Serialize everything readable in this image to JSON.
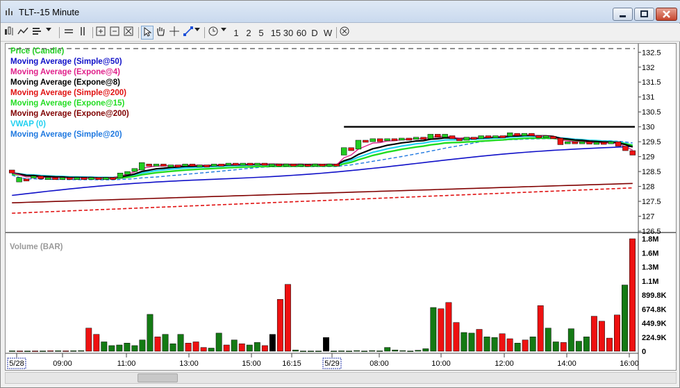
{
  "window": {
    "title": "TLT--15 Minute"
  },
  "toolbar": {
    "intervals": [
      "1",
      "2",
      "5",
      "15",
      "30",
      "60",
      "D",
      "W"
    ]
  },
  "legend": [
    {
      "label": "Price (Candle)",
      "color": "#22cc22"
    },
    {
      "label": "Moving Average (Simple@50)",
      "color": "#1010c8"
    },
    {
      "label": "Moving Average (Expone@4)",
      "color": "#e0208a"
    },
    {
      "label": "Moving Average (Expone@8)",
      "color": "#000000"
    },
    {
      "label": "Moving Average (Simple@200)",
      "color": "#e01010"
    },
    {
      "label": "Moving Average (Expone@15)",
      "color": "#22dd22"
    },
    {
      "label": "Moving Average (Expone@200)",
      "color": "#800000"
    },
    {
      "label": "VWAP (0)",
      "color": "#20d0f0"
    },
    {
      "label": "Moving Average (Simple@20)",
      "color": "#1e78e0"
    }
  ],
  "price_axis": [
    "132.5",
    "132",
    "131.5",
    "131",
    "130.5",
    "130",
    "129.5",
    "129",
    "128.5",
    "128",
    "127.5",
    "127",
    "126.5"
  ],
  "volume_label": "Volume (BAR)",
  "volume_axis": [
    "1.8M",
    "1.6M",
    "1.3M",
    "1.1M",
    "899.8K",
    "674.8K",
    "449.9K",
    "224.9K",
    "0"
  ],
  "chart_data": {
    "type": "bar",
    "time_labels": [
      "5/28",
      "09:00",
      "11:00",
      "13:00",
      "15:00",
      "16:15",
      "5/29",
      "08:00",
      "10:00",
      "12:00",
      "14:00",
      "16:00"
    ],
    "price": {
      "ylim": [
        126.5,
        132.6
      ],
      "horizontal_line": 130.0,
      "sma200_start": 127.1,
      "sma200_end": 127.95,
      "ema200_start": 127.45,
      "ema200_end": 128.1,
      "sma50_start": 127.7,
      "sma50_end": 129.35,
      "candles": [
        {
          "o": 128.55,
          "c": 128.45,
          "up": false
        },
        {
          "o": 128.15,
          "c": 128.3,
          "up": true
        },
        {
          "o": 128.25,
          "c": 128.2,
          "up": false
        },
        {
          "o": 128.3,
          "c": 128.35,
          "up": true
        },
        {
          "o": 128.35,
          "c": 128.25,
          "up": false
        },
        {
          "o": 128.25,
          "c": 128.3,
          "up": true
        },
        {
          "o": 128.3,
          "c": 128.28,
          "up": false
        },
        {
          "o": 128.28,
          "c": 128.3,
          "up": true
        },
        {
          "o": 128.3,
          "c": 128.25,
          "up": false
        },
        {
          "o": 128.25,
          "c": 128.3,
          "up": true
        },
        {
          "o": 128.3,
          "c": 128.28,
          "up": false
        },
        {
          "o": 128.25,
          "c": 128.3,
          "up": true
        },
        {
          "o": 128.3,
          "c": 128.25,
          "up": false
        },
        {
          "o": 128.25,
          "c": 128.3,
          "up": true
        },
        {
          "o": 128.3,
          "c": 128.28,
          "up": false
        },
        {
          "o": 128.28,
          "c": 128.45,
          "up": true
        },
        {
          "o": 128.4,
          "c": 128.5,
          "up": true
        },
        {
          "o": 128.5,
          "c": 128.6,
          "up": true
        },
        {
          "o": 128.55,
          "c": 128.8,
          "up": true
        },
        {
          "o": 128.75,
          "c": 128.7,
          "up": false
        },
        {
          "o": 128.7,
          "c": 128.75,
          "up": true
        },
        {
          "o": 128.75,
          "c": 128.68,
          "up": false
        },
        {
          "o": 128.7,
          "c": 128.72,
          "up": true
        },
        {
          "o": 128.72,
          "c": 128.7,
          "up": false
        },
        {
          "o": 128.7,
          "c": 128.75,
          "up": true
        },
        {
          "o": 128.75,
          "c": 128.7,
          "up": false
        },
        {
          "o": 128.7,
          "c": 128.72,
          "up": true
        },
        {
          "o": 128.72,
          "c": 128.7,
          "up": false
        },
        {
          "o": 128.7,
          "c": 128.75,
          "up": true
        },
        {
          "o": 128.75,
          "c": 128.72,
          "up": false
        },
        {
          "o": 128.72,
          "c": 128.78,
          "up": true
        },
        {
          "o": 128.78,
          "c": 128.72,
          "up": false
        },
        {
          "o": 128.72,
          "c": 128.78,
          "up": true
        },
        {
          "o": 128.78,
          "c": 128.75,
          "up": false
        },
        {
          "o": 128.75,
          "c": 128.78,
          "up": true
        },
        {
          "o": 128.78,
          "c": 128.72,
          "up": false
        },
        {
          "o": 128.72,
          "c": 128.75,
          "up": true
        },
        {
          "o": 128.75,
          "c": 128.72,
          "up": false
        },
        {
          "o": 128.72,
          "c": 128.75,
          "up": true
        },
        {
          "o": 128.75,
          "c": 128.72,
          "up": false
        },
        {
          "o": 128.72,
          "c": 128.74,
          "up": true
        },
        {
          "o": 128.74,
          "c": 128.72,
          "up": false
        },
        {
          "o": 128.72,
          "c": 128.75,
          "up": true
        },
        {
          "o": 128.75,
          "c": 128.72,
          "up": false
        },
        {
          "o": 128.7,
          "c": 128.75,
          "up": true
        },
        {
          "o": 128.75,
          "c": 128.72,
          "up": false
        },
        {
          "o": 129.05,
          "c": 129.3,
          "up": true
        },
        {
          "o": 129.3,
          "c": 129.2,
          "up": false
        },
        {
          "o": 129.25,
          "c": 129.55,
          "up": true
        },
        {
          "o": 129.55,
          "c": 129.5,
          "up": false
        },
        {
          "o": 129.5,
          "c": 129.6,
          "up": true
        },
        {
          "o": 129.6,
          "c": 129.5,
          "up": false
        },
        {
          "o": 129.55,
          "c": 129.6,
          "up": true
        },
        {
          "o": 129.6,
          "c": 129.55,
          "up": false
        },
        {
          "o": 129.55,
          "c": 129.62,
          "up": true
        },
        {
          "o": 129.62,
          "c": 129.58,
          "up": false
        },
        {
          "o": 129.58,
          "c": 129.65,
          "up": true
        },
        {
          "o": 129.65,
          "c": 129.58,
          "up": false
        },
        {
          "o": 129.6,
          "c": 129.75,
          "up": true
        },
        {
          "o": 129.75,
          "c": 129.65,
          "up": false
        },
        {
          "o": 129.65,
          "c": 129.75,
          "up": true
        },
        {
          "o": 129.7,
          "c": 129.6,
          "up": false
        },
        {
          "o": 129.6,
          "c": 129.55,
          "up": false
        },
        {
          "o": 129.55,
          "c": 129.65,
          "up": true
        },
        {
          "o": 129.65,
          "c": 129.6,
          "up": false
        },
        {
          "o": 129.6,
          "c": 129.7,
          "up": true
        },
        {
          "o": 129.7,
          "c": 129.65,
          "up": false
        },
        {
          "o": 129.65,
          "c": 129.7,
          "up": true
        },
        {
          "o": 129.7,
          "c": 129.68,
          "up": false
        },
        {
          "o": 129.68,
          "c": 129.8,
          "up": true
        },
        {
          "o": 129.78,
          "c": 129.7,
          "up": false
        },
        {
          "o": 129.7,
          "c": 129.78,
          "up": true
        },
        {
          "o": 129.78,
          "c": 129.7,
          "up": false
        },
        {
          "o": 129.7,
          "c": 129.65,
          "up": false
        },
        {
          "o": 129.65,
          "c": 129.7,
          "up": true
        },
        {
          "o": 129.68,
          "c": 129.6,
          "up": false
        },
        {
          "o": 129.62,
          "c": 129.4,
          "up": false
        },
        {
          "o": 129.45,
          "c": 129.5,
          "up": true
        },
        {
          "o": 129.5,
          "c": 129.45,
          "up": false
        },
        {
          "o": 129.45,
          "c": 129.5,
          "up": true
        },
        {
          "o": 129.5,
          "c": 129.42,
          "up": false
        },
        {
          "o": 129.45,
          "c": 129.48,
          "up": true
        },
        {
          "o": 129.48,
          "c": 129.42,
          "up": false
        },
        {
          "o": 129.45,
          "c": 129.5,
          "up": true
        },
        {
          "o": 129.5,
          "c": 129.35,
          "up": false
        },
        {
          "o": 129.35,
          "c": 129.2,
          "up": false
        },
        {
          "o": 129.2,
          "c": 129.05,
          "up": false
        }
      ]
    },
    "volume": {
      "ylim": [
        0,
        1800000
      ],
      "bars": [
        {
          "v": 6000,
          "c": "g"
        },
        {
          "v": 5000,
          "c": "r"
        },
        {
          "v": 4000,
          "c": "g"
        },
        {
          "v": 5000,
          "c": "r"
        },
        {
          "v": 5000,
          "c": "g"
        },
        {
          "v": 8000,
          "c": "r"
        },
        {
          "v": 8000,
          "c": "g"
        },
        {
          "v": 6000,
          "c": "r"
        },
        {
          "v": 8000,
          "c": "g"
        },
        {
          "v": 10000,
          "c": "g"
        },
        {
          "v": 370000,
          "c": "r"
        },
        {
          "v": 270000,
          "c": "r"
        },
        {
          "v": 150000,
          "c": "g"
        },
        {
          "v": 90000,
          "c": "g"
        },
        {
          "v": 100000,
          "c": "g"
        },
        {
          "v": 130000,
          "c": "g"
        },
        {
          "v": 90000,
          "c": "g"
        },
        {
          "v": 180000,
          "c": "g"
        },
        {
          "v": 590000,
          "c": "g"
        },
        {
          "v": 230000,
          "c": "r"
        },
        {
          "v": 270000,
          "c": "g"
        },
        {
          "v": 120000,
          "c": "g"
        },
        {
          "v": 270000,
          "c": "g"
        },
        {
          "v": 130000,
          "c": "r"
        },
        {
          "v": 150000,
          "c": "r"
        },
        {
          "v": 60000,
          "c": "r"
        },
        {
          "v": 50000,
          "c": "g"
        },
        {
          "v": 290000,
          "c": "g"
        },
        {
          "v": 100000,
          "c": "r"
        },
        {
          "v": 180000,
          "c": "g"
        },
        {
          "v": 120000,
          "c": "r"
        },
        {
          "v": 100000,
          "c": "g"
        },
        {
          "v": 140000,
          "c": "g"
        },
        {
          "v": 90000,
          "c": "r"
        },
        {
          "v": 270000,
          "c": "k"
        },
        {
          "v": 830000,
          "c": "r"
        },
        {
          "v": 1070000,
          "c": "r"
        },
        {
          "v": 20000,
          "c": "g"
        },
        {
          "v": 4000,
          "c": "g"
        },
        {
          "v": 4000,
          "c": "g"
        },
        {
          "v": 4000,
          "c": "g"
        },
        {
          "v": 220000,
          "c": "k"
        },
        {
          "v": 4000,
          "c": "g"
        },
        {
          "v": 6000,
          "c": "g"
        },
        {
          "v": 4000,
          "c": "g"
        },
        {
          "v": 10000,
          "c": "g"
        },
        {
          "v": 4000,
          "c": "g"
        },
        {
          "v": 10000,
          "c": "g"
        },
        {
          "v": 6000,
          "c": "g"
        },
        {
          "v": 60000,
          "c": "g"
        },
        {
          "v": 20000,
          "c": "g"
        },
        {
          "v": 10000,
          "c": "g"
        },
        {
          "v": 4000,
          "c": "g"
        },
        {
          "v": 15000,
          "c": "g"
        },
        {
          "v": 40000,
          "c": "g"
        },
        {
          "v": 700000,
          "c": "g"
        },
        {
          "v": 680000,
          "c": "r"
        },
        {
          "v": 780000,
          "c": "r"
        },
        {
          "v": 460000,
          "c": "r"
        },
        {
          "v": 300000,
          "c": "g"
        },
        {
          "v": 290000,
          "c": "g"
        },
        {
          "v": 350000,
          "c": "r"
        },
        {
          "v": 230000,
          "c": "g"
        },
        {
          "v": 220000,
          "c": "g"
        },
        {
          "v": 280000,
          "c": "r"
        },
        {
          "v": 200000,
          "c": "r"
        },
        {
          "v": 130000,
          "c": "g"
        },
        {
          "v": 180000,
          "c": "r"
        },
        {
          "v": 230000,
          "c": "g"
        },
        {
          "v": 730000,
          "c": "r"
        },
        {
          "v": 370000,
          "c": "g"
        },
        {
          "v": 150000,
          "c": "g"
        },
        {
          "v": 140000,
          "c": "r"
        },
        {
          "v": 360000,
          "c": "g"
        },
        {
          "v": 160000,
          "c": "g"
        },
        {
          "v": 230000,
          "c": "g"
        },
        {
          "v": 560000,
          "c": "r"
        },
        {
          "v": 480000,
          "c": "r"
        },
        {
          "v": 210000,
          "c": "r"
        },
        {
          "v": 580000,
          "c": "r"
        },
        {
          "v": 1060000,
          "c": "g"
        },
        {
          "v": 1800000,
          "c": "r"
        }
      ]
    }
  }
}
